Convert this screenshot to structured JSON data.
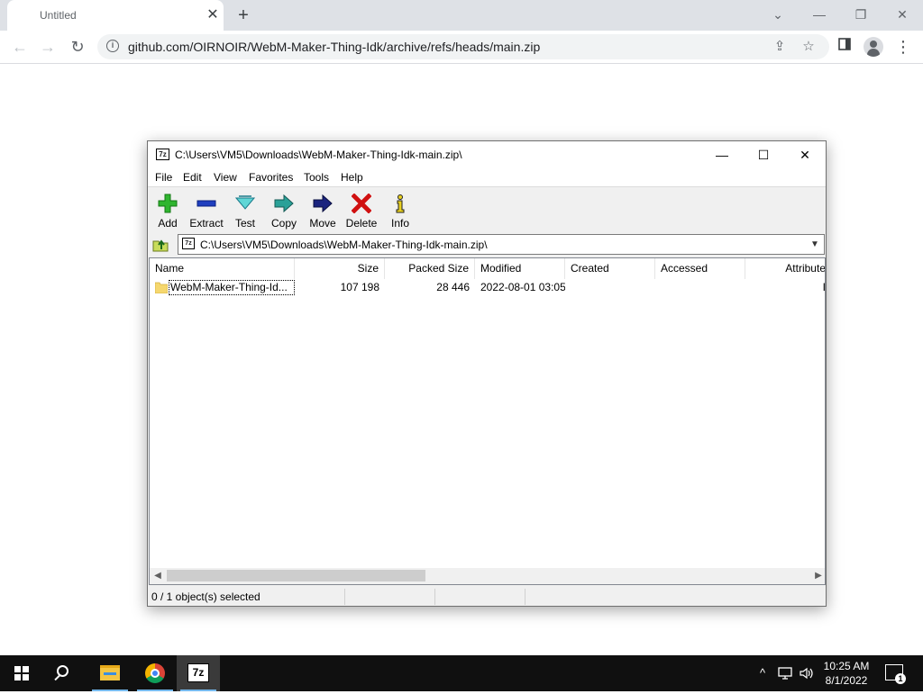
{
  "browser": {
    "tab": {
      "title": "Untitled",
      "close": "✕"
    },
    "new_tab": "+",
    "window_controls": {
      "tab_search": "⌄",
      "minimize": "—",
      "restore": "❐",
      "close": "✕"
    },
    "nav": {
      "back": "←",
      "forward": "→",
      "reload": "↻"
    },
    "url": "github.com/OIRNOIR/WebM-Maker-Thing-Idk/archive/refs/heads/main.zip",
    "icons": {
      "site_info": "info-icon",
      "share": "share-icon",
      "bookmark": "star-icon",
      "side_panel": "side-panel-icon",
      "profile": "profile-icon",
      "menu": "kebab-menu-icon"
    }
  },
  "sevenzip": {
    "title": "C:\\Users\\VM5\\Downloads\\WebM-Maker-Thing-Idk-main.zip\\",
    "app_icon_text": "7z",
    "window_controls": {
      "minimize": "—",
      "maximize": "☐",
      "close": "✕"
    },
    "menu": [
      "File",
      "Edit",
      "View",
      "Favorites",
      "Tools",
      "Help"
    ],
    "toolbar": [
      {
        "label": "Add",
        "icon": "add-icon"
      },
      {
        "label": "Extract",
        "icon": "extract-icon"
      },
      {
        "label": "Test",
        "icon": "test-icon"
      },
      {
        "label": "Copy",
        "icon": "copy-icon"
      },
      {
        "label": "Move",
        "icon": "move-icon"
      },
      {
        "label": "Delete",
        "icon": "delete-icon"
      },
      {
        "label": "Info",
        "icon": "info-icon"
      }
    ],
    "address": "C:\\Users\\VM5\\Downloads\\WebM-Maker-Thing-Idk-main.zip\\",
    "columns": [
      "Name",
      "Size",
      "Packed Size",
      "Modified",
      "Created",
      "Accessed",
      "Attribute"
    ],
    "rows": [
      {
        "name": "WebM-Maker-Thing-Id...",
        "size": "107 198",
        "packed_size": "28 446",
        "modified": "2022-08-01 03:05",
        "created": "",
        "accessed": "",
        "attributes": "I"
      }
    ],
    "status": {
      "selection": "0 / 1 object(s) selected",
      "cell2": "",
      "cell3": "",
      "cell4": ""
    }
  },
  "taskbar": {
    "items": [
      "start-icon",
      "search-icon",
      "file-explorer-icon",
      "chrome-icon",
      "7zip-icon"
    ],
    "sevenzip_label": "7z",
    "tray": {
      "chevron": "^",
      "network": "network-icon",
      "volume": "volume-icon"
    },
    "clock": {
      "time": "10:25 AM",
      "date": "8/1/2022"
    },
    "notifications": {
      "count": "1"
    }
  }
}
